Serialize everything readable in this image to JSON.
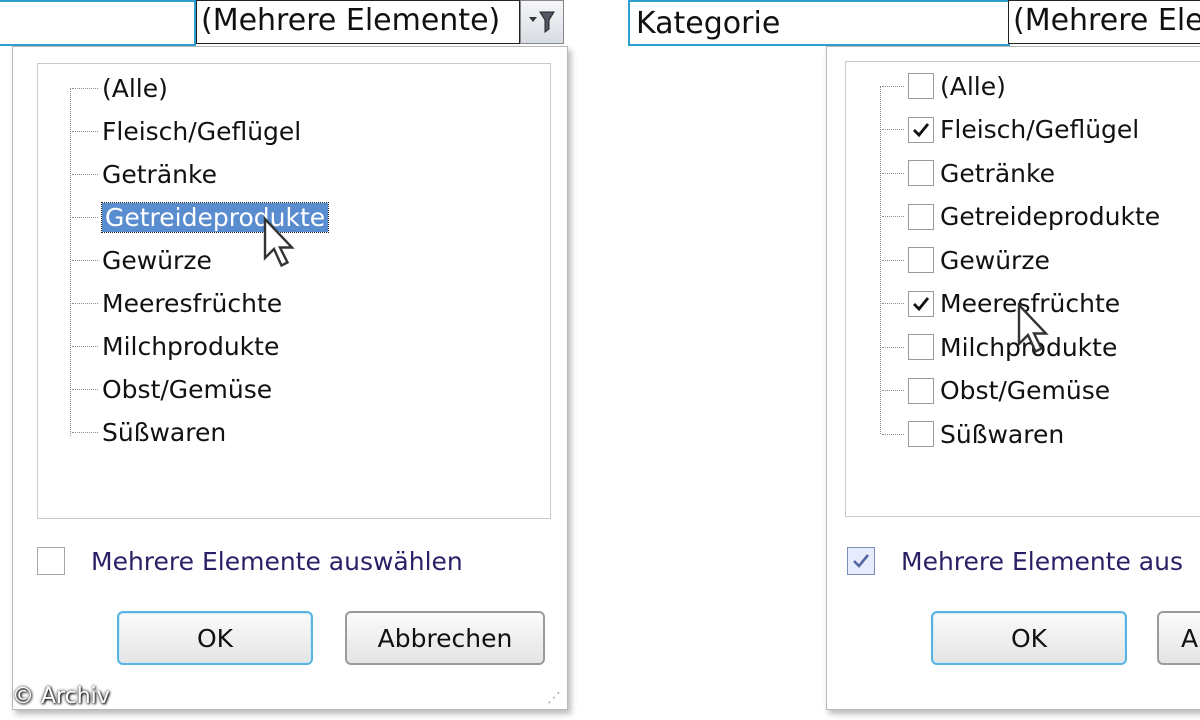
{
  "left": {
    "header": {
      "value": "(Mehrere Elemente)",
      "filter_icon": "filter-dropdown-icon"
    },
    "items": [
      "(Alle)",
      "Fleisch/Geflügel",
      "Getränke",
      "Getreideprodukte",
      "Gewürze",
      "Meeresfrüchte",
      "Milchprodukte",
      "Obst/Gemüse",
      "Süßwaren"
    ],
    "selected_item": "Getreideprodukte",
    "multi_select_label": "Mehrere Elemente auswählen",
    "multi_select_checked": false,
    "ok_label": "OK",
    "cancel_label": "Abbrechen"
  },
  "right": {
    "header": {
      "label": "Kategorie",
      "value": "(Mehrere Ele"
    },
    "items": [
      {
        "label": "(Alle)",
        "checked": false
      },
      {
        "label": "Fleisch/Geflügel",
        "checked": true
      },
      {
        "label": "Getränke",
        "checked": false
      },
      {
        "label": "Getreideprodukte",
        "checked": false
      },
      {
        "label": "Gewürze",
        "checked": false
      },
      {
        "label": "Meeresfrüchte",
        "checked": true
      },
      {
        "label": "Milchprodukte",
        "checked": false
      },
      {
        "label": "Obst/Gemüse",
        "checked": false
      },
      {
        "label": "Süßwaren",
        "checked": false
      }
    ],
    "multi_select_label": "Mehrere Elemente aus",
    "multi_select_checked": true,
    "ok_label": "OK",
    "cancel_label": "A"
  },
  "watermark": "© Archiv",
  "colors": {
    "selection": "#5a8dd0",
    "accent_border": "#2f9fd0",
    "multi_label": "#2b1f66"
  }
}
